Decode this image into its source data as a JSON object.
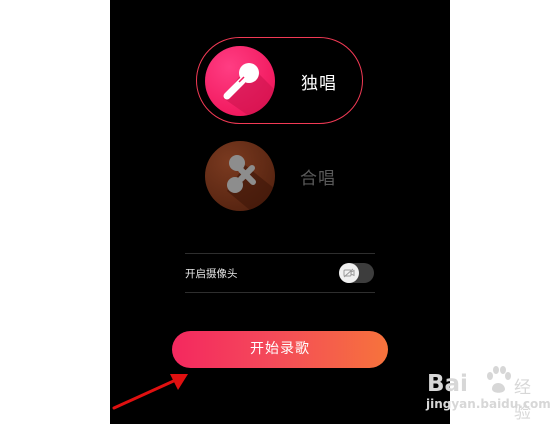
{
  "mode_select": {
    "solo": {
      "label": "独唱",
      "icon": "microphone-icon"
    },
    "chorus": {
      "label": "合唱",
      "icon": "two-microphones-icon"
    }
  },
  "camera": {
    "label": "开启摄像头",
    "enabled": false,
    "icon": "camera-off-icon"
  },
  "start_button": {
    "label": "开始录歌"
  },
  "watermark": {
    "text_left": "Bai",
    "text_right": "经验",
    "url": "jingyan.baidu.com"
  },
  "colors": {
    "solo_accent": "#f21b60",
    "chorus_circle": "#5a2612",
    "button_gradient_start": "#f4285f",
    "button_gradient_end": "#f6733c",
    "arrow": "#e01010"
  }
}
